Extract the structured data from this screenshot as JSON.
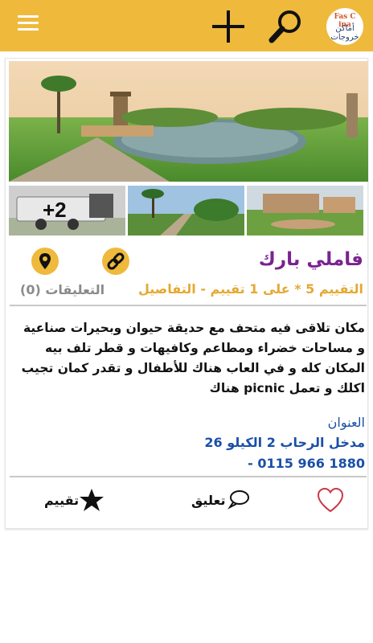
{
  "colors": {
    "accent": "#efb93c",
    "title": "#7a2390",
    "rating": "#e4a933",
    "address": "#1a4fa8",
    "heart": "#c8394a"
  },
  "header": {
    "menu_icon": "hamburger-menu-icon",
    "add_icon": "plus-icon",
    "search_icon": "search-icon",
    "logo_text": "Fas C ina",
    "logo_sub": "أماكن خروجات"
  },
  "place": {
    "title": "فاملي بارك",
    "rating_text": "التقييم 5 * على 1 تقييم - التفاصيل",
    "comments_count": "التعليقات (0)",
    "extra_photos": "+2",
    "description": "مكان تلاقى فيه متحف مع حديقة حيوان وبحيرات صناعية و مساحات خضراء ومطاعم وكافيهات و قطر تلف بيه المكان كله و في العاب هناك للأطفال و تقدر كمان تجيب اكلك و تعمل picnic هناك",
    "address_label": "العنوان",
    "address": "مدخل الرحاب 2 الكيلو 26",
    "phone": "1880 966 0115 -"
  },
  "actions": {
    "rate_label": "تقييم",
    "comment_label": "تعليق"
  }
}
